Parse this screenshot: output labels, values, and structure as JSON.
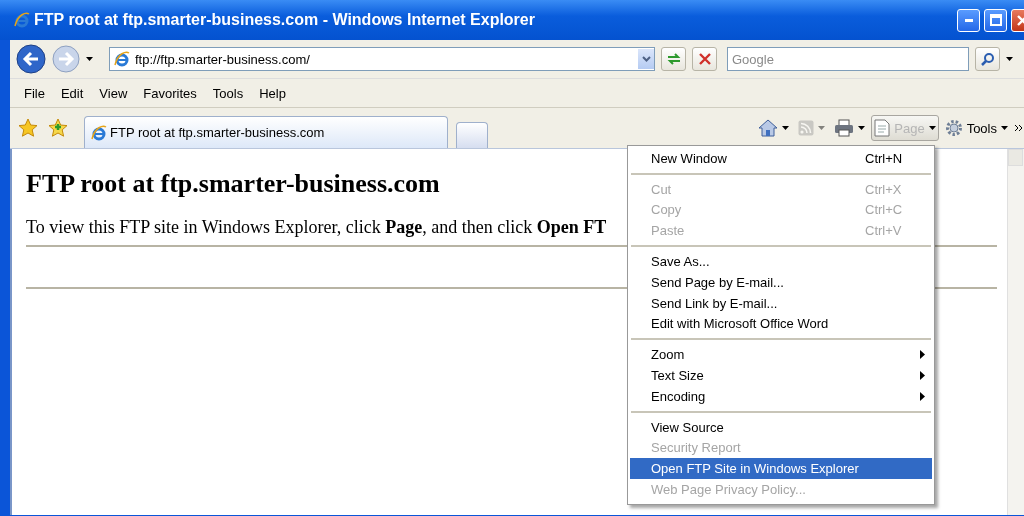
{
  "window": {
    "title": "FTP root at ftp.smarter-business.com - Windows Internet Explorer"
  },
  "address_bar": {
    "value": "ftp://ftp.smarter-business.com/"
  },
  "search": {
    "placeholder": "Google"
  },
  "menu_bar": [
    "File",
    "Edit",
    "View",
    "Favorites",
    "Tools",
    "Help"
  ],
  "tabs": [
    {
      "label": "FTP root at ftp.smarter-business.com",
      "selected": true
    }
  ],
  "command_bar": [
    {
      "kind": "home",
      "disabled": false,
      "active": false
    },
    {
      "kind": "feeds",
      "disabled": true,
      "active": false
    },
    {
      "kind": "print",
      "disabled": false,
      "active": false
    },
    {
      "kind": "page",
      "label": "Page",
      "disabled": false,
      "active": true
    },
    {
      "kind": "tools",
      "label": "Tools",
      "disabled": false,
      "active": false
    }
  ],
  "page": {
    "heading": "FTP root at ftp.smarter-business.com",
    "paragraph": "To view this FTP site in Windows Explorer, click **Page**, and then click **Open FT**"
  },
  "menu": {
    "items": [
      {
        "kind": "item",
        "label": "New Window",
        "shortcut": "Ctrl+N",
        "disabled": false,
        "selected": false,
        "submenu": false
      },
      {
        "kind": "separator"
      },
      {
        "kind": "item",
        "label": "Cut",
        "shortcut": "Ctrl+X",
        "disabled": true,
        "selected": false,
        "submenu": false
      },
      {
        "kind": "item",
        "label": "Copy",
        "shortcut": "Ctrl+C",
        "disabled": true,
        "selected": false,
        "submenu": false
      },
      {
        "kind": "item",
        "label": "Paste",
        "shortcut": "Ctrl+V",
        "disabled": true,
        "selected": false,
        "submenu": false
      },
      {
        "kind": "separator"
      },
      {
        "kind": "item",
        "label": "Save As...",
        "disabled": false,
        "selected": false,
        "submenu": false
      },
      {
        "kind": "item",
        "label": "Send Page by E-mail...",
        "disabled": false,
        "selected": false,
        "submenu": false
      },
      {
        "kind": "item",
        "label": "Send Link by E-mail...",
        "disabled": false,
        "selected": false,
        "submenu": false
      },
      {
        "kind": "item",
        "label": "Edit with Microsoft Office Word",
        "disabled": false,
        "selected": false,
        "submenu": false
      },
      {
        "kind": "separator"
      },
      {
        "kind": "item",
        "label": "Zoom",
        "disabled": false,
        "selected": false,
        "submenu": true
      },
      {
        "kind": "item",
        "label": "Text Size",
        "disabled": false,
        "selected": false,
        "submenu": true
      },
      {
        "kind": "item",
        "label": "Encoding",
        "disabled": false,
        "selected": false,
        "submenu": true
      },
      {
        "kind": "separator"
      },
      {
        "kind": "item",
        "label": "View Source",
        "disabled": false,
        "selected": false,
        "submenu": false
      },
      {
        "kind": "item",
        "label": "Security Report",
        "disabled": true,
        "selected": false,
        "submenu": false
      },
      {
        "kind": "item",
        "label": "Open FTP Site in Windows Explorer",
        "disabled": false,
        "selected": true,
        "submenu": false
      },
      {
        "kind": "item",
        "label": "Web Page Privacy Policy...",
        "disabled": true,
        "selected": false,
        "submenu": false
      }
    ]
  }
}
